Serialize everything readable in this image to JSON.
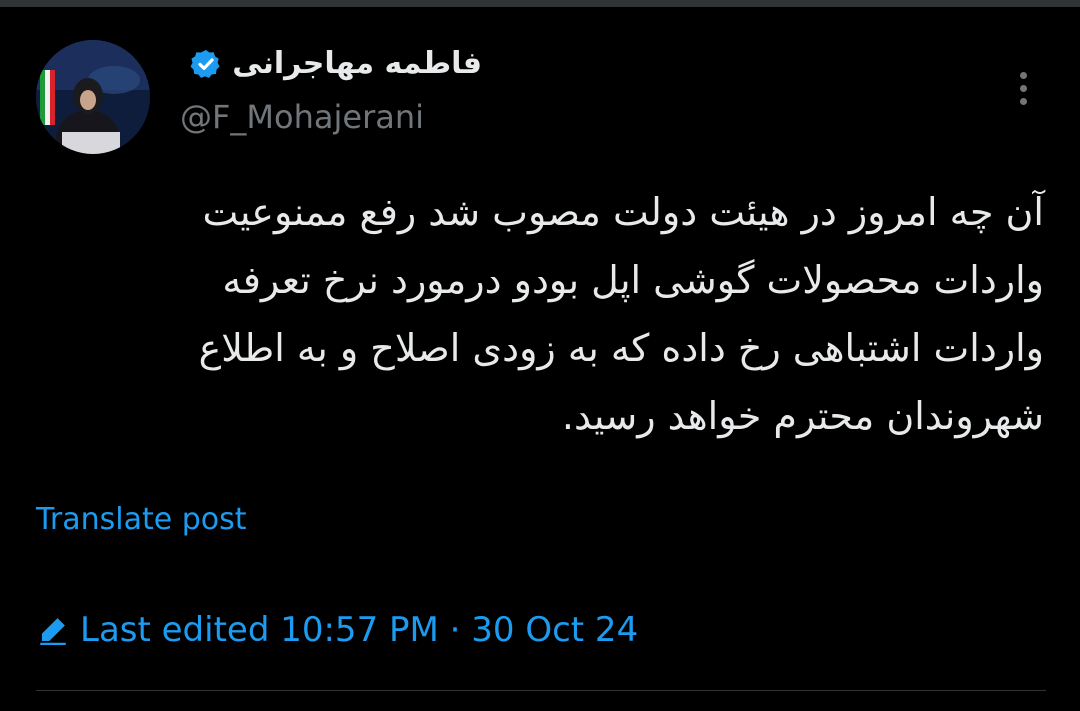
{
  "author": {
    "display_name": "فاطمه مهاجرانی",
    "handle": "@F_Mohajerani",
    "verified": true,
    "avatar_icon": "profile-photo"
  },
  "post": {
    "text": "آن چه امروز در هیئت دولت مصوب شد رفع ممنوعیت\nواردات محصولات گوشی اپل بودو درمورد نرخ تعرفه\nواردات اشتباهی رخ داده که به زودی اصلاح و به اطلاع\nشهروندان محترم خواهد رسید."
  },
  "actions": {
    "translate_label": "Translate post",
    "more_icon": "more-options-icon"
  },
  "edit_info": {
    "label": "Last edited 10:57 PM · 30 Oct 24",
    "icon": "pencil-icon"
  },
  "colors": {
    "background": "#000000",
    "text_primary": "#e7e9ea",
    "text_secondary": "#71767b",
    "accent": "#1d9bf0"
  }
}
